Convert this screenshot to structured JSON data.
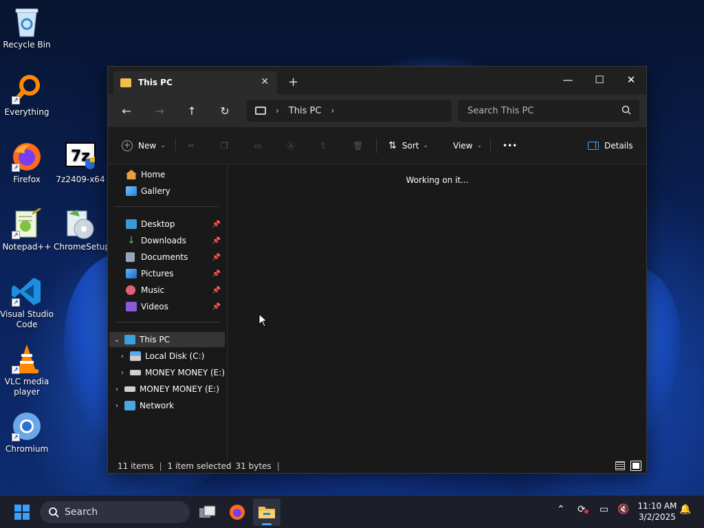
{
  "desktop": {
    "icons": [
      {
        "label": "Recycle Bin"
      },
      {
        "label": "Everything"
      },
      {
        "label": "Firefox"
      },
      {
        "label": "7z2409-x64"
      },
      {
        "label": "Notepad++"
      },
      {
        "label": "ChromeSetup"
      },
      {
        "label": "Visual Studio Code"
      },
      {
        "label": "VLC media player"
      },
      {
        "label": "Chromium"
      }
    ]
  },
  "explorer": {
    "tab_title": "This PC",
    "breadcrumb": [
      "This PC"
    ],
    "search_placeholder": "Search This PC",
    "commands": {
      "new": "New",
      "sort": "Sort",
      "view": "View",
      "more": "•••",
      "details": "Details"
    },
    "nav": {
      "quick": [
        {
          "label": "Home"
        },
        {
          "label": "Gallery"
        }
      ],
      "pinned": [
        {
          "label": "Desktop"
        },
        {
          "label": "Downloads"
        },
        {
          "label": "Documents"
        },
        {
          "label": "Pictures"
        },
        {
          "label": "Music"
        },
        {
          "label": "Videos"
        }
      ],
      "tree": [
        {
          "label": "This PC"
        },
        {
          "label": "Local Disk (C:)"
        },
        {
          "label": "MONEY MONEY (E:)"
        },
        {
          "label": "MONEY MONEY (E:)"
        },
        {
          "label": "Network"
        }
      ]
    },
    "content_message": "Working on it...",
    "status": {
      "items": "11 items",
      "selection": "1 item selected",
      "size": "31 bytes"
    }
  },
  "taskbar": {
    "search_placeholder": "Search",
    "time": "11:10 AM",
    "date": "3/2/2025"
  },
  "colors": {
    "folder": "#f2c04a",
    "window_bg": "#191919",
    "accent": "#4aa3ff"
  }
}
